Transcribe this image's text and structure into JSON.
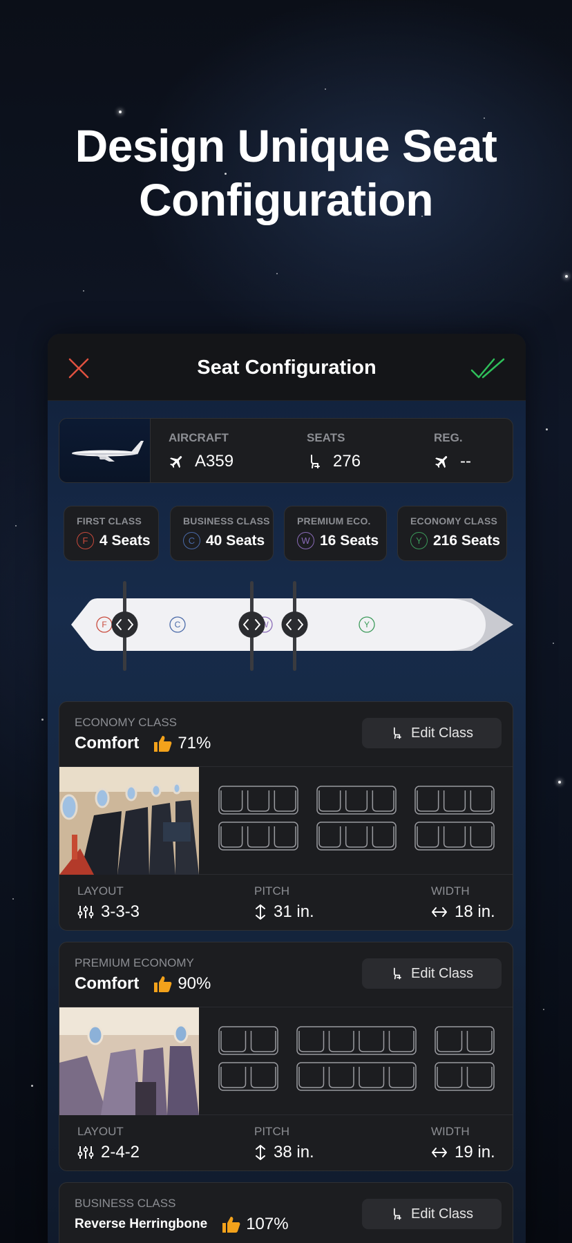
{
  "headline": {
    "line1": "Design Unique Seat",
    "line2": "Configuration"
  },
  "window": {
    "title": "Seat Configuration",
    "close_icon": "close-icon",
    "confirm_icon": "double-check-icon",
    "accent_close": "#e0513f",
    "accent_confirm": "#2fbf5a"
  },
  "aircraft": {
    "aircraft_label": "AIRCRAFT",
    "aircraft_value": "A359",
    "seats_label": "SEATS",
    "seats_value": "276",
    "reg_label": "REG.",
    "reg_value": "--"
  },
  "classes_summary": [
    {
      "label": "FIRST CLASS",
      "code": "F",
      "value": "4 Seats",
      "color": "#c94a3c"
    },
    {
      "label": "BUSINESS CLASS",
      "code": "C",
      "value": "40 Seats",
      "color": "#4a6aa8"
    },
    {
      "label": "PREMIUM ECO.",
      "code": "W",
      "value": "16 Seats",
      "color": "#8a6bb8"
    },
    {
      "label": "ECONOMY CLASS",
      "code": "Y",
      "value": "216 Seats",
      "color": "#3c9a5a"
    }
  ],
  "fuselage": {
    "codes": [
      "F",
      "C",
      "W",
      "Y"
    ]
  },
  "class_cards": [
    {
      "category": "ECONOMY CLASS",
      "name": "Comfort",
      "rating": "71%",
      "edit_label": "Edit Class",
      "layout_label": "LAYOUT",
      "layout_value": "3-3-3",
      "pitch_label": "PITCH",
      "pitch_value": "31 in.",
      "width_label": "WIDTH",
      "width_value": "18 in."
    },
    {
      "category": "PREMIUM ECONOMY",
      "name": "Comfort",
      "rating": "90%",
      "edit_label": "Edit Class",
      "layout_label": "LAYOUT",
      "layout_value": "2-4-2",
      "pitch_label": "PITCH",
      "pitch_value": "38 in.",
      "width_label": "WIDTH",
      "width_value": "19 in."
    },
    {
      "category": "BUSINESS CLASS",
      "name": "Reverse Herringbone",
      "rating": "107%",
      "edit_label": "Edit Class"
    }
  ]
}
